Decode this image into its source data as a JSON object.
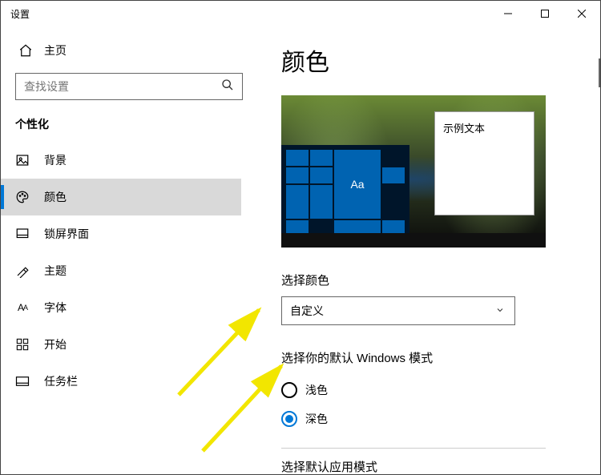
{
  "window": {
    "title": "设置"
  },
  "sidebar": {
    "home_label": "主页",
    "search_placeholder": "查找设置",
    "section_title": "个性化",
    "items": [
      {
        "label": "背景"
      },
      {
        "label": "颜色"
      },
      {
        "label": "锁屏界面"
      },
      {
        "label": "主题"
      },
      {
        "label": "字体"
      },
      {
        "label": "开始"
      },
      {
        "label": "任务栏"
      }
    ],
    "selected_index": 1
  },
  "content": {
    "page_title": "颜色",
    "preview": {
      "sample_text": "示例文本",
      "tile_glyph": "Aa"
    },
    "choose_color_label": "选择颜色",
    "choose_color_value": "自定义",
    "windows_mode_label": "选择你的默认 Windows 模式",
    "windows_mode_options": [
      {
        "label": "浅色",
        "checked": false
      },
      {
        "label": "深色",
        "checked": true
      }
    ],
    "app_mode_label": "选择默认应用模式"
  }
}
